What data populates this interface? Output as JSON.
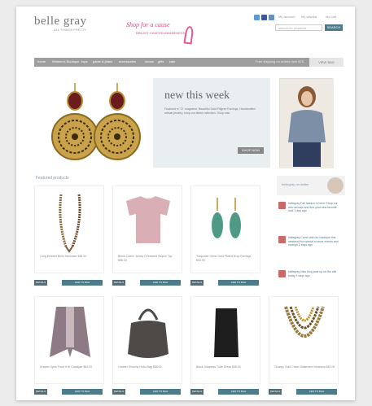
{
  "header": {
    "logo_main": "belle gray",
    "logo_sub": "ALL THINGS PRETTY",
    "banner_main": "Shop for a cause",
    "banner_sub": "BREAST CANCER AWARENESS",
    "util_links": [
      "My account",
      "My wishlist",
      "My cart"
    ],
    "search_placeholder": "search for products",
    "search_button": "SEARCH"
  },
  "nav": {
    "items": [
      "home",
      "Women's Boutique",
      "tops",
      "pants & jeans",
      "accessories",
      "shoes",
      "gifts",
      "sale"
    ],
    "promo": "Free shipping on orders over $75",
    "right": "VIEW BAG"
  },
  "hero": {
    "title": "new this week",
    "text": "Featured in \"O\" magazine. Beautiful Gold Filigree Earrings. Handcrafted artisan jewelry, shop our latest collection. Shop now.",
    "button": "SHOP NOW"
  },
  "section_title": "Featured products",
  "products": [
    {
      "name": "Long Beaded Boho Necklace",
      "price": "$48.00"
    },
    {
      "name": "Blush Cotton Jersey Oversized Sequin Top",
      "price": "$58.00"
    },
    {
      "name": "Turquoise Stone Gold Plated Drop Earrings",
      "price": "$32.00"
    },
    {
      "name": "Draped Open Front Knit Cardigan",
      "price": "$64.00"
    },
    {
      "name": "Leather Slouchy Hobo Bag",
      "price": "$88.00"
    },
    {
      "name": "Black Strapless Tube Dress",
      "price": "$46.00"
    },
    {
      "name": "Chunky Gold Chain Statement Necklace",
      "price": "$52.00"
    }
  ],
  "buttons": {
    "details": "DETAILS",
    "add": "ADD TO BAG"
  },
  "twitter": {
    "label": "bellegray on twitter",
    "tweets": [
      "bellegray Fall fashion is here! Shop our new arrivals and find your new favorite look 1 day ago",
      "bellegray Come visit our boutique this weekend for special in-store events and savings 2 days ago",
      "bellegray New blog post up on the site today 3 days ago"
    ]
  },
  "colors": {
    "accent": "#4c7b8a",
    "nav": "#9e9e9e",
    "pink": "#d2508a"
  }
}
